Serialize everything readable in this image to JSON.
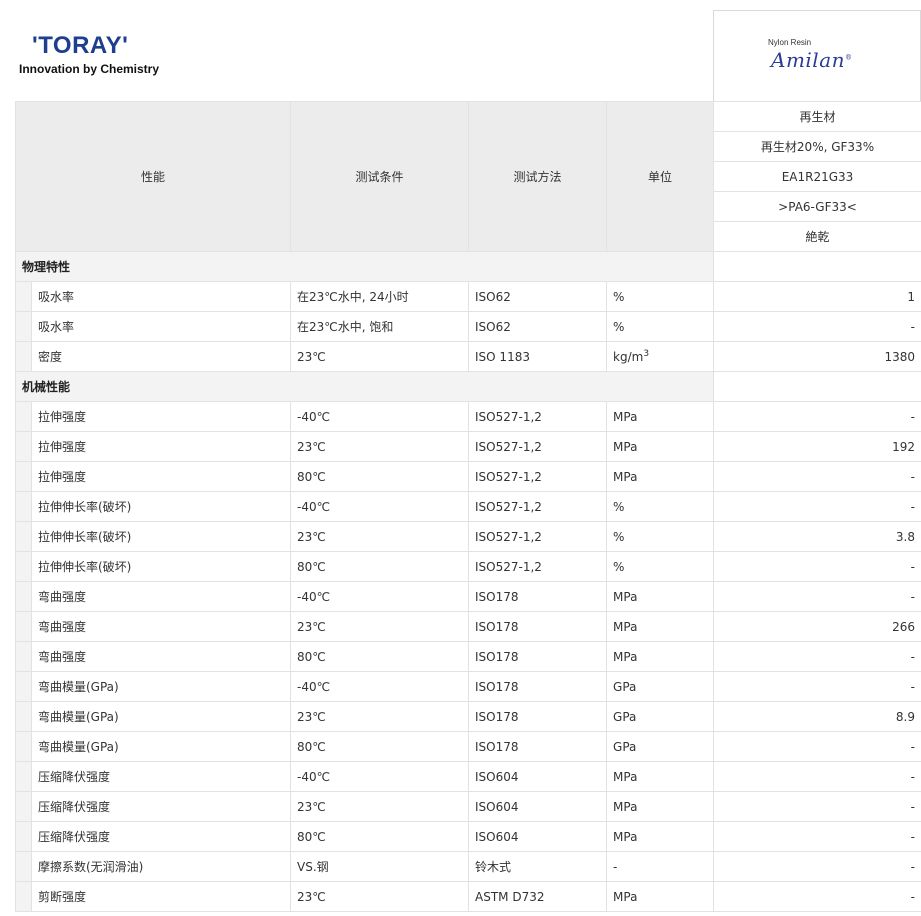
{
  "logos": {
    "toray": "'TORAY'",
    "toray_tagline": "Innovation by Chemistry",
    "amilan_small": "Nylon Resin",
    "amilan_script": "Amilan",
    "amilan_mark": "®"
  },
  "header": {
    "property": "性能",
    "condition": "测试条件",
    "method": "测试方法",
    "unit": "单位"
  },
  "grade": {
    "type": "再生材",
    "desc": "再生材20%, GF33%",
    "code": "EA1R21G33",
    "marking": ">PA6-GF33<",
    "state": "絶乾"
  },
  "sections": [
    {
      "title": "物理特性",
      "rows": [
        {
          "property": "吸水率",
          "condition": "在23℃水中, 24小时",
          "method": "ISO62",
          "unit": "%",
          "value": "1"
        },
        {
          "property": "吸水率",
          "condition": "在23℃水中, 饱和",
          "method": "ISO62",
          "unit": "%",
          "value": "-"
        },
        {
          "property": "密度",
          "condition": "23℃",
          "method": "ISO 1183",
          "unit": "kg/m",
          "unit_sup": "3",
          "value": "1380"
        }
      ]
    },
    {
      "title": "机械性能",
      "rows": [
        {
          "property": "拉伸强度",
          "condition": "-40℃",
          "method": "ISO527-1,2",
          "unit": "MPa",
          "value": "-"
        },
        {
          "property": "拉伸强度",
          "condition": "23℃",
          "method": "ISO527-1,2",
          "unit": "MPa",
          "value": "192"
        },
        {
          "property": "拉伸强度",
          "condition": "80℃",
          "method": "ISO527-1,2",
          "unit": "MPa",
          "value": "-"
        },
        {
          "property": "拉伸伸长率(破坏)",
          "condition": "-40℃",
          "method": "ISO527-1,2",
          "unit": "%",
          "value": "-"
        },
        {
          "property": "拉伸伸长率(破坏)",
          "condition": "23℃",
          "method": "ISO527-1,2",
          "unit": "%",
          "value": "3.8"
        },
        {
          "property": "拉伸伸长率(破坏)",
          "condition": "80℃",
          "method": "ISO527-1,2",
          "unit": "%",
          "value": "-"
        },
        {
          "property": "弯曲强度",
          "condition": "-40℃",
          "method": "ISO178",
          "unit": "MPa",
          "value": "-"
        },
        {
          "property": "弯曲强度",
          "condition": "23℃",
          "method": "ISO178",
          "unit": "MPa",
          "value": "266"
        },
        {
          "property": "弯曲强度",
          "condition": "80℃",
          "method": "ISO178",
          "unit": "MPa",
          "value": "-"
        },
        {
          "property": "弯曲模量(GPa)",
          "condition": "-40℃",
          "method": "ISO178",
          "unit": "GPa",
          "value": "-"
        },
        {
          "property": "弯曲模量(GPa)",
          "condition": "23℃",
          "method": "ISO178",
          "unit": "GPa",
          "value": "8.9"
        },
        {
          "property": "弯曲模量(GPa)",
          "condition": "80℃",
          "method": "ISO178",
          "unit": "GPa",
          "value": "-"
        },
        {
          "property": "压缩降伏强度",
          "condition": "-40℃",
          "method": "ISO604",
          "unit": "MPa",
          "value": "-"
        },
        {
          "property": "压缩降伏强度",
          "condition": "23℃",
          "method": "ISO604",
          "unit": "MPa",
          "value": "-"
        },
        {
          "property": "压缩降伏强度",
          "condition": "80℃",
          "method": "ISO604",
          "unit": "MPa",
          "value": "-"
        },
        {
          "property": "摩擦系数(无润滑油)",
          "condition": "VS.钢",
          "method": "铃木式",
          "unit": "-",
          "value": "-"
        },
        {
          "property": "剪断强度",
          "condition": "23℃",
          "method": "ASTM D732",
          "unit": "MPa",
          "value": "-"
        }
      ]
    }
  ],
  "colors": {
    "toray_blue": "#1e3f8f",
    "amilan_blue": "#2b3c97",
    "header_bg": "#ececec",
    "border": "#e2e2e2"
  }
}
